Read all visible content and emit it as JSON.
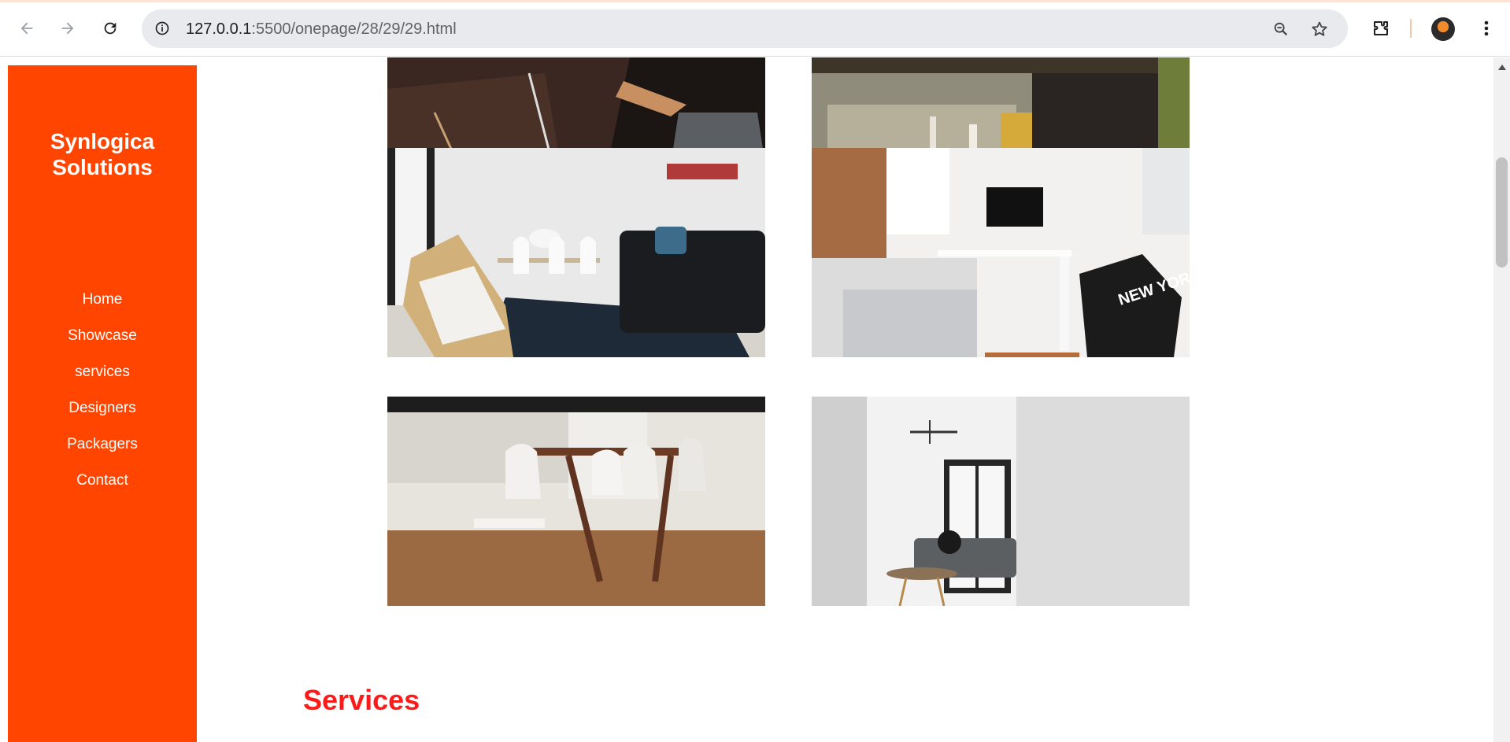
{
  "browser": {
    "url_host": "127.0.0.1",
    "url_path": ":5500/onepage/28/29/29.html",
    "icons": [
      "back-arrow-icon",
      "forward-arrow-icon",
      "reload-icon",
      "site-info-icon",
      "zoom-icon",
      "bookmark-star-icon",
      "extensions-icon",
      "profile-avatar",
      "menu-dots-icon"
    ]
  },
  "sidebar": {
    "brand_line1": "Synlogica",
    "brand_line2": "Solutions",
    "bg_color": "#ff4500",
    "nav": [
      "Home",
      "Showcase",
      "services",
      "Designers",
      "Packagers",
      "Contact"
    ]
  },
  "gallery": {
    "photos": [
      "photo-dark-desk",
      "photo-living-room-couch",
      "photo-living-dining-chairs",
      "photo-bedroom-desk-new-york",
      "photo-dining-table-white-chairs",
      "photo-bright-room-sofa"
    ],
    "pillow_text": "NEW YORK"
  },
  "services": {
    "title": "Services",
    "title_color": "#ff1a1a"
  }
}
